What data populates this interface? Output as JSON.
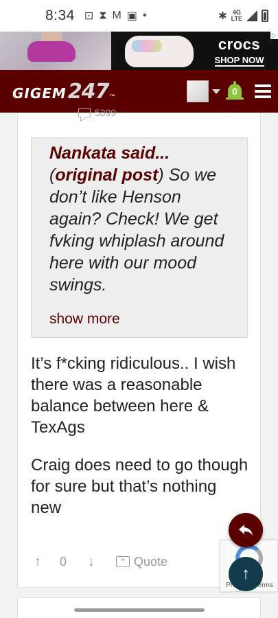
{
  "status_bar": {
    "time": "8:34",
    "network": "4G",
    "network_sub": "LTE"
  },
  "ad": {
    "brand": "crocs",
    "cta": "SHOP NOW"
  },
  "header": {
    "logo_word": "GIGEM",
    "logo_num": "247",
    "logo_tm": "™",
    "notification_count": "0"
  },
  "post": {
    "view_count": "5399",
    "quote": {
      "author": "Nankata said...",
      "link": "original post",
      "text_before": "(",
      "text_after": ") So we don’t like Henson again? Check! We get fvking whiplash around here with our mood swings.",
      "show_more": "show more"
    },
    "paragraphs": [
      "It’s f*cking ridiculous.. I wish there was a reasonable balance between here & TexAgs",
      "Craig does need to go though for sure but that’s nothing new"
    ],
    "actions": {
      "score": "0",
      "quote_label": "Quote"
    }
  },
  "recaptcha": {
    "text": "Privacy - Terms"
  },
  "colors": {
    "brand": "#5a0000",
    "bell": "#8fc43c",
    "scroll_top": "#123b4c"
  }
}
